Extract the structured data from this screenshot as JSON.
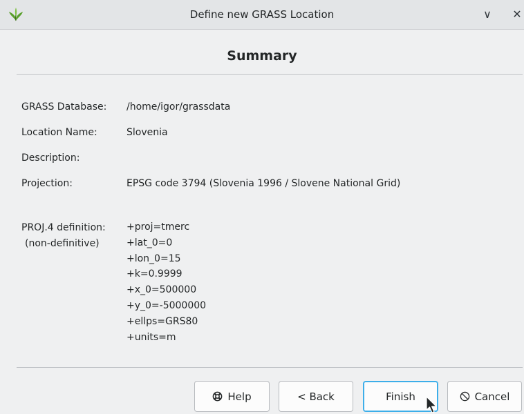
{
  "window": {
    "title": "Define new GRASS Location",
    "minimize_glyph": "∨",
    "close_glyph": "✕"
  },
  "page": {
    "heading": "Summary"
  },
  "summary": {
    "database_label": "GRASS Database:",
    "database_value": "/home/igor/grassdata",
    "location_label": "Location Name:",
    "location_value": "Slovenia",
    "description_label": "Description:",
    "description_value": "",
    "projection_label": "Projection:",
    "projection_value": "EPSG code 3794 (Slovenia 1996 / Slovene National Grid)",
    "proj4_label": "PROJ.4 definition:",
    "proj4_sublabel": "(non-definitive)",
    "proj4_lines": [
      "+proj=tmerc",
      "+lat_0=0",
      "+lon_0=15",
      "+k=0.9999",
      "+x_0=500000",
      "+y_0=-5000000",
      "+ellps=GRS80",
      "+units=m"
    ]
  },
  "buttons": {
    "help": "Help",
    "back": "< Back",
    "finish": "Finish",
    "cancel": "Cancel"
  },
  "icons": {
    "app": "grass-leaf-icon",
    "help": "lifebuoy-icon",
    "cancel": "cancel-circle-icon",
    "cursor": "mouse-pointer-icon"
  },
  "colors": {
    "background": "#eff0f1",
    "focus_border": "#3daee9",
    "app_icon_green": "#5aa02c"
  }
}
